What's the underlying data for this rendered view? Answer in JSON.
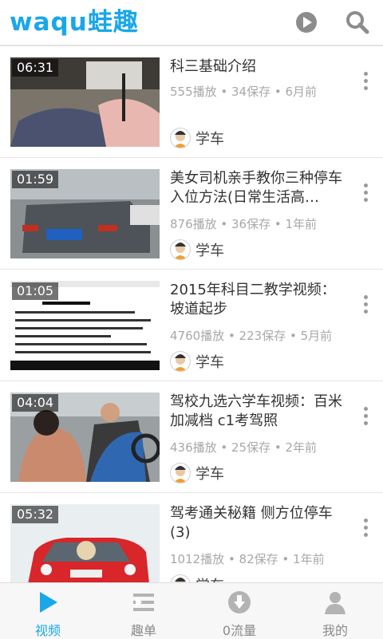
{
  "brand": {
    "logo_text": "waqu蛙趣",
    "accent": "#1aa7e8"
  },
  "header": {
    "play_icon": "play-circle-icon",
    "search_icon": "search-icon"
  },
  "videos": [
    {
      "duration": "06:31",
      "title": "科三基础介绍",
      "stats_line1": "555播放 • 34保存 • 6月前",
      "stats_line2": "",
      "channel": "学车"
    },
    {
      "duration": "01:59",
      "title": "美女司机亲手教你三种停车入位方法(日常生活高…",
      "stats_line1": "",
      "stats_line2": "876播放 • 36保存 • 1年前",
      "channel": "学车"
    },
    {
      "duration": "01:05",
      "title": "2015年科目二教学视频：坡道起步",
      "stats_line1": "",
      "stats_line2": "4760播放 • 223保存 • 5月前",
      "channel": "学车"
    },
    {
      "duration": "04:04",
      "title": "驾校九选六学车视频：百米加减档 c1考驾照",
      "stats_line1": "",
      "stats_line2": "436播放 • 25保存 • 2年前",
      "channel": "学车"
    },
    {
      "duration": "05:32",
      "title": "驾考通关秘籍 侧方位停车(3)",
      "stats_line1": "",
      "stats_line2": "1012播放 • 82保存 • 1年前",
      "channel": "学车"
    }
  ],
  "tabs": [
    {
      "label": "视频",
      "icon": "play-icon",
      "active": true
    },
    {
      "label": "趣单",
      "icon": "list-icon",
      "active": false
    },
    {
      "label": "0流量",
      "icon": "download-icon",
      "active": false
    },
    {
      "label": "我的",
      "icon": "person-icon",
      "active": false
    }
  ]
}
